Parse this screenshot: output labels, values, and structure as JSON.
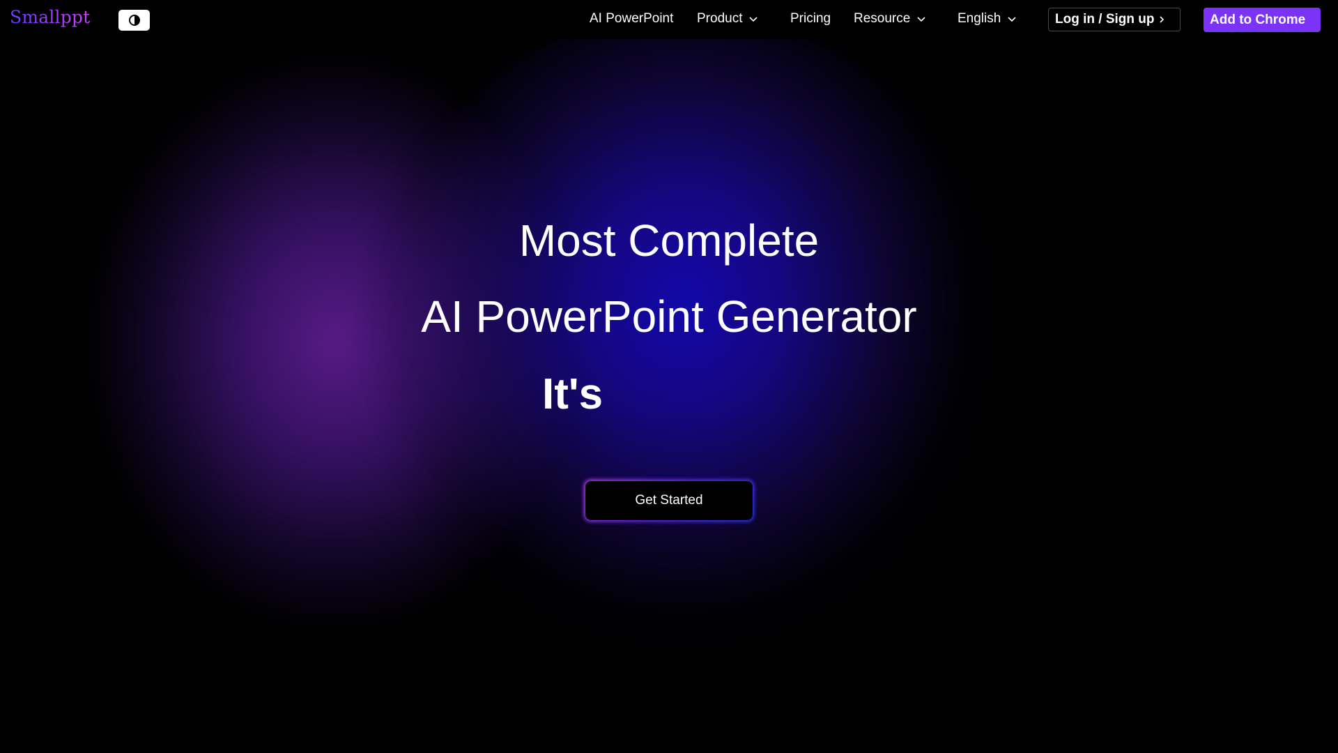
{
  "brand": {
    "logo_text": "Smallppt"
  },
  "nav": {
    "theme_toggle_icon": "contrast-icon",
    "links": [
      {
        "label": "AI PowerPoint",
        "has_dropdown": false
      },
      {
        "label": "Product",
        "has_dropdown": true
      },
      {
        "label": "Pricing",
        "has_dropdown": false
      },
      {
        "label": "Resource",
        "has_dropdown": true
      },
      {
        "label": "English",
        "has_dropdown": true
      }
    ],
    "login_label": "Log in / Sign up",
    "chrome_label": "Add to Chrome"
  },
  "hero": {
    "line1": "Most Complete",
    "line2": "AI PowerPoint Generator",
    "typing_text": "It's",
    "cta_label": "Get Started"
  },
  "colors": {
    "background": "#000000",
    "accent_purple": "#7b33f7",
    "glow_blue": "#1208aa",
    "glow_purple": "#5c1c8c"
  }
}
